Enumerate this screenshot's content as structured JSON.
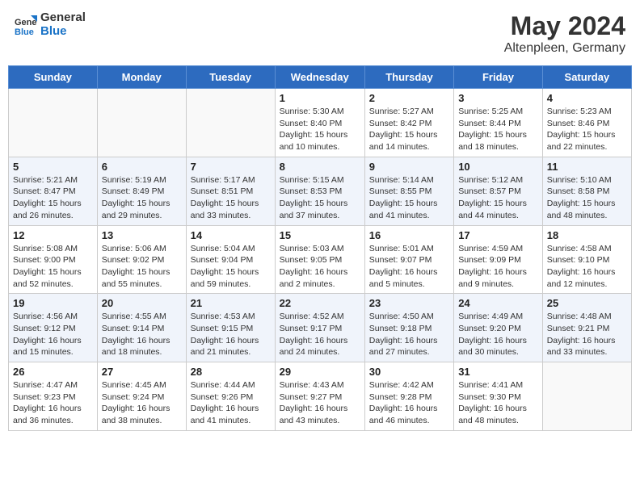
{
  "header": {
    "logo_line1": "General",
    "logo_line2": "Blue",
    "month_year": "May 2024",
    "location": "Altenpleen, Germany"
  },
  "weekdays": [
    "Sunday",
    "Monday",
    "Tuesday",
    "Wednesday",
    "Thursday",
    "Friday",
    "Saturday"
  ],
  "weeks": [
    [
      {
        "day": "",
        "info": ""
      },
      {
        "day": "",
        "info": ""
      },
      {
        "day": "",
        "info": ""
      },
      {
        "day": "1",
        "info": "Sunrise: 5:30 AM\nSunset: 8:40 PM\nDaylight: 15 hours\nand 10 minutes."
      },
      {
        "day": "2",
        "info": "Sunrise: 5:27 AM\nSunset: 8:42 PM\nDaylight: 15 hours\nand 14 minutes."
      },
      {
        "day": "3",
        "info": "Sunrise: 5:25 AM\nSunset: 8:44 PM\nDaylight: 15 hours\nand 18 minutes."
      },
      {
        "day": "4",
        "info": "Sunrise: 5:23 AM\nSunset: 8:46 PM\nDaylight: 15 hours\nand 22 minutes."
      }
    ],
    [
      {
        "day": "5",
        "info": "Sunrise: 5:21 AM\nSunset: 8:47 PM\nDaylight: 15 hours\nand 26 minutes."
      },
      {
        "day": "6",
        "info": "Sunrise: 5:19 AM\nSunset: 8:49 PM\nDaylight: 15 hours\nand 29 minutes."
      },
      {
        "day": "7",
        "info": "Sunrise: 5:17 AM\nSunset: 8:51 PM\nDaylight: 15 hours\nand 33 minutes."
      },
      {
        "day": "8",
        "info": "Sunrise: 5:15 AM\nSunset: 8:53 PM\nDaylight: 15 hours\nand 37 minutes."
      },
      {
        "day": "9",
        "info": "Sunrise: 5:14 AM\nSunset: 8:55 PM\nDaylight: 15 hours\nand 41 minutes."
      },
      {
        "day": "10",
        "info": "Sunrise: 5:12 AM\nSunset: 8:57 PM\nDaylight: 15 hours\nand 44 minutes."
      },
      {
        "day": "11",
        "info": "Sunrise: 5:10 AM\nSunset: 8:58 PM\nDaylight: 15 hours\nand 48 minutes."
      }
    ],
    [
      {
        "day": "12",
        "info": "Sunrise: 5:08 AM\nSunset: 9:00 PM\nDaylight: 15 hours\nand 52 minutes."
      },
      {
        "day": "13",
        "info": "Sunrise: 5:06 AM\nSunset: 9:02 PM\nDaylight: 15 hours\nand 55 minutes."
      },
      {
        "day": "14",
        "info": "Sunrise: 5:04 AM\nSunset: 9:04 PM\nDaylight: 15 hours\nand 59 minutes."
      },
      {
        "day": "15",
        "info": "Sunrise: 5:03 AM\nSunset: 9:05 PM\nDaylight: 16 hours\nand 2 minutes."
      },
      {
        "day": "16",
        "info": "Sunrise: 5:01 AM\nSunset: 9:07 PM\nDaylight: 16 hours\nand 5 minutes."
      },
      {
        "day": "17",
        "info": "Sunrise: 4:59 AM\nSunset: 9:09 PM\nDaylight: 16 hours\nand 9 minutes."
      },
      {
        "day": "18",
        "info": "Sunrise: 4:58 AM\nSunset: 9:10 PM\nDaylight: 16 hours\nand 12 minutes."
      }
    ],
    [
      {
        "day": "19",
        "info": "Sunrise: 4:56 AM\nSunset: 9:12 PM\nDaylight: 16 hours\nand 15 minutes."
      },
      {
        "day": "20",
        "info": "Sunrise: 4:55 AM\nSunset: 9:14 PM\nDaylight: 16 hours\nand 18 minutes."
      },
      {
        "day": "21",
        "info": "Sunrise: 4:53 AM\nSunset: 9:15 PM\nDaylight: 16 hours\nand 21 minutes."
      },
      {
        "day": "22",
        "info": "Sunrise: 4:52 AM\nSunset: 9:17 PM\nDaylight: 16 hours\nand 24 minutes."
      },
      {
        "day": "23",
        "info": "Sunrise: 4:50 AM\nSunset: 9:18 PM\nDaylight: 16 hours\nand 27 minutes."
      },
      {
        "day": "24",
        "info": "Sunrise: 4:49 AM\nSunset: 9:20 PM\nDaylight: 16 hours\nand 30 minutes."
      },
      {
        "day": "25",
        "info": "Sunrise: 4:48 AM\nSunset: 9:21 PM\nDaylight: 16 hours\nand 33 minutes."
      }
    ],
    [
      {
        "day": "26",
        "info": "Sunrise: 4:47 AM\nSunset: 9:23 PM\nDaylight: 16 hours\nand 36 minutes."
      },
      {
        "day": "27",
        "info": "Sunrise: 4:45 AM\nSunset: 9:24 PM\nDaylight: 16 hours\nand 38 minutes."
      },
      {
        "day": "28",
        "info": "Sunrise: 4:44 AM\nSunset: 9:26 PM\nDaylight: 16 hours\nand 41 minutes."
      },
      {
        "day": "29",
        "info": "Sunrise: 4:43 AM\nSunset: 9:27 PM\nDaylight: 16 hours\nand 43 minutes."
      },
      {
        "day": "30",
        "info": "Sunrise: 4:42 AM\nSunset: 9:28 PM\nDaylight: 16 hours\nand 46 minutes."
      },
      {
        "day": "31",
        "info": "Sunrise: 4:41 AM\nSunset: 9:30 PM\nDaylight: 16 hours\nand 48 minutes."
      },
      {
        "day": "",
        "info": ""
      }
    ]
  ]
}
